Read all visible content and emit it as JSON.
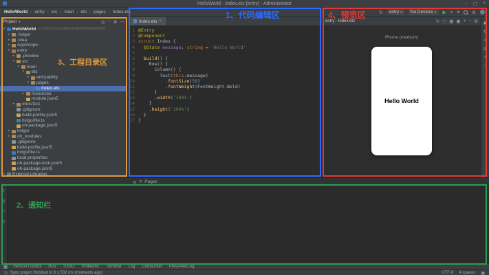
{
  "colors": {
    "annotation_blue": "#2f6bff",
    "annotation_red": "#e53935",
    "annotation_orange": "#e09a3c",
    "annotation_green": "#2e9e4f",
    "selection_blue": "#4b6eaf",
    "run_green": "#5aa865"
  },
  "icons": {
    "chevron": "▾",
    "separator": "›",
    "minimize": "–",
    "maximize": "▢",
    "close": "×",
    "sync": "↻",
    "run": "▶",
    "debug": "●",
    "stop": "■",
    "settings": "⚙",
    "grid": "▦",
    "bell": "◉"
  },
  "annotations": {
    "editor": "1、代码编辑区",
    "notification": "2、通知栏",
    "project": "3、工程目录区",
    "preview": "4、预览区"
  },
  "title_bar": {
    "title": "HelloWorld - Index.ets [entry] - Administrator"
  },
  "toolbar": {
    "breadcrumb": [
      "HelloWorld",
      "entry",
      "src",
      "main",
      "ets",
      "pages",
      "Index.ets"
    ],
    "run_config": "entry",
    "device": "No Devices"
  },
  "project_panel": {
    "header": "Project",
    "header_icons": [
      {
        "name": "locate-icon",
        "glyph": "◎"
      },
      {
        "name": "collapse-all-icon",
        "glyph": "−"
      },
      {
        "name": "settings-icon",
        "glyph": "⚙"
      },
      {
        "name": "hide-panel-icon",
        "glyph": "—"
      }
    ],
    "tree": [
      {
        "label": "HelloWorld",
        "extra": "D:\\DevEcoStudioProjects\\HelloWorld",
        "indent": 0,
        "icon": "project",
        "kind": "folder",
        "expanded": true,
        "root": true
      },
      {
        "label": ".hvigor",
        "indent": 1,
        "icon": "folder",
        "kind": "folder"
      },
      {
        "label": ".idea",
        "indent": 1,
        "icon": "folder",
        "kind": "folder"
      },
      {
        "label": "AppScope",
        "indent": 1,
        "icon": "folder",
        "kind": "folder"
      },
      {
        "label": "entry",
        "indent": 1,
        "icon": "module",
        "kind": "folder",
        "expanded": true
      },
      {
        "label": ".preview",
        "indent": 2,
        "icon": "folder",
        "kind": "folder"
      },
      {
        "label": "src",
        "indent": 2,
        "icon": "folder",
        "kind": "folder",
        "expanded": true
      },
      {
        "label": "main",
        "indent": 3,
        "icon": "folder",
        "kind": "folder",
        "expanded": true
      },
      {
        "label": "ets",
        "indent": 4,
        "icon": "folder",
        "kind": "folder",
        "expanded": true
      },
      {
        "label": "entryability",
        "indent": 5,
        "icon": "folder",
        "kind": "folder"
      },
      {
        "label": "pages",
        "indent": 5,
        "icon": "folder",
        "kind": "folder",
        "expanded": true
      },
      {
        "label": "Index.ets",
        "indent": 6,
        "icon": "ets",
        "kind": "file",
        "selected": true
      },
      {
        "label": "resources",
        "indent": 4,
        "icon": "folder",
        "kind": "folder"
      },
      {
        "label": "module.json5",
        "indent": 4,
        "icon": "json",
        "kind": "file"
      },
      {
        "label": "ohosTest",
        "indent": 2,
        "icon": "folder",
        "kind": "folder"
      },
      {
        "label": ".gitignore",
        "indent": 2,
        "icon": "file",
        "kind": "file"
      },
      {
        "label": "build-profile.json5",
        "indent": 2,
        "icon": "json",
        "kind": "file"
      },
      {
        "label": "hvigorfile.ts",
        "indent": 2,
        "icon": "ts",
        "kind": "file"
      },
      {
        "label": "oh-package.json5",
        "indent": 2,
        "icon": "json",
        "kind": "file"
      },
      {
        "label": "hvigor",
        "indent": 1,
        "icon": "folder",
        "kind": "folder"
      },
      {
        "label": "oh_modules",
        "indent": 1,
        "icon": "folder",
        "kind": "folder"
      },
      {
        "label": ".gitignore",
        "indent": 1,
        "icon": "file",
        "kind": "file"
      },
      {
        "label": "build-profile.json5",
        "indent": 1,
        "icon": "json",
        "kind": "file"
      },
      {
        "label": "hvigorfile.ts",
        "indent": 1,
        "icon": "ts",
        "kind": "file"
      },
      {
        "label": "local.properties",
        "indent": 1,
        "icon": "file",
        "kind": "file"
      },
      {
        "label": "oh-package-lock.json5",
        "indent": 1,
        "icon": "json",
        "kind": "file"
      },
      {
        "label": "oh-package.json5",
        "indent": 1,
        "icon": "json",
        "kind": "file"
      },
      {
        "label": "External Libraries",
        "indent": 0,
        "icon": "lib",
        "kind": "folder"
      }
    ]
  },
  "editor": {
    "tab": "Index.ets",
    "lines": [
      [
        {
          "t": "@Entry",
          "c": "ann"
        }
      ],
      [
        {
          "t": "@Component",
          "c": "ann"
        }
      ],
      [
        {
          "t": "struct",
          "c": "kw"
        },
        {
          "t": " Index {",
          "c": "plain"
        }
      ],
      [
        {
          "t": "  ",
          "c": "plain"
        },
        {
          "t": "@State",
          "c": "ann"
        },
        {
          "t": " ",
          "c": "plain"
        },
        {
          "t": "message",
          "c": "prop"
        },
        {
          "t": ": ",
          "c": "plain"
        },
        {
          "t": "string",
          "c": "kw"
        },
        {
          "t": " = ",
          "c": "plain"
        },
        {
          "t": "'Hello World'",
          "c": "str"
        }
      ],
      [],
      [
        {
          "t": "  ",
          "c": "plain"
        },
        {
          "t": "build",
          "c": "fn"
        },
        {
          "t": "() {",
          "c": "plain"
        }
      ],
      [
        {
          "t": "    Row() {",
          "c": "plain"
        }
      ],
      [
        {
          "t": "      Column() {",
          "c": "plain"
        }
      ],
      [
        {
          "t": "        Text(",
          "c": "plain"
        },
        {
          "t": "this",
          "c": "kw"
        },
        {
          "t": ".message)",
          "c": "plain"
        }
      ],
      [
        {
          "t": "          .",
          "c": "plain"
        },
        {
          "t": "fontSize",
          "c": "fn"
        },
        {
          "t": "(",
          "c": "plain"
        },
        {
          "t": "50",
          "c": "num"
        },
        {
          "t": ")",
          "c": "plain"
        }
      ],
      [
        {
          "t": "          .",
          "c": "plain"
        },
        {
          "t": "fontWeight",
          "c": "fn"
        },
        {
          "t": "(FontWeight.Bold)",
          "c": "plain"
        }
      ],
      [
        {
          "t": "      }",
          "c": "plain"
        }
      ],
      [
        {
          "t": "      .",
          "c": "plain"
        },
        {
          "t": "width",
          "c": "fn"
        },
        {
          "t": "(",
          "c": "plain"
        },
        {
          "t": "'100%'",
          "c": "str"
        },
        {
          "t": ")",
          "c": "plain"
        }
      ],
      [
        {
          "t": "    }",
          "c": "plain"
        }
      ],
      [
        {
          "t": "    .",
          "c": "plain"
        },
        {
          "t": "height",
          "c": "fn"
        },
        {
          "t": "(",
          "c": "plain"
        },
        {
          "t": "'100%'",
          "c": "str"
        },
        {
          "t": ")",
          "c": "plain"
        }
      ],
      [
        {
          "t": "  }",
          "c": "plain"
        }
      ],
      [
        {
          "t": "}",
          "c": "plain"
        }
      ]
    ]
  },
  "previewer": {
    "tab": "entry · Index.ets",
    "profile": "Phone (medium)",
    "preview_text": "Hello World",
    "header_icons": [
      {
        "name": "refresh-icon",
        "glyph": "↻"
      },
      {
        "name": "orientation-icon",
        "glyph": "▢"
      },
      {
        "name": "grid-icon",
        "glyph": "▦"
      },
      {
        "name": "inspector-icon",
        "glyph": "▣"
      },
      {
        "name": "zoom-in-icon",
        "glyph": "+"
      },
      {
        "name": "zoom-out-icon",
        "glyph": "−"
      },
      {
        "name": "settings-icon",
        "glyph": "⚙"
      }
    ],
    "side_icons": [
      {
        "name": "inspector-icon",
        "glyph": "▣"
      },
      {
        "name": "rotate-icon",
        "glyph": "↻"
      },
      {
        "name": "component-tree-icon",
        "glyph": "≡"
      },
      {
        "name": "multi-preview-icon",
        "glyph": "⊞"
      },
      {
        "name": "zoom-in-icon",
        "glyph": "+"
      },
      {
        "name": "zoom-out-icon",
        "glyph": "−"
      }
    ]
  },
  "bottom_panel": {
    "label": "Pages",
    "icons": [
      {
        "name": "blocked-icon",
        "glyph": "⊘"
      },
      {
        "name": "list-icon",
        "glyph": "≡"
      }
    ]
  },
  "notification_panel": {
    "stripe_icons": [
      {
        "name": "list-icon",
        "glyph": "≡"
      },
      {
        "name": "pin-icon",
        "glyph": "▤"
      },
      {
        "name": "history-icon",
        "glyph": "↻"
      },
      {
        "name": "clear-icon",
        "glyph": "⊘"
      }
    ]
  },
  "tool_bar": {
    "items": [
      "Version Control",
      "Run",
      "TODO",
      "Problems",
      "Terminal",
      "Log",
      "CodeLinter",
      "PreviewerLog"
    ]
  },
  "status_bar": {
    "message": "Sync project finished in 6 s 532 ms (moments ago)",
    "encoding": "UTF-8",
    "indent": "4 spaces"
  }
}
